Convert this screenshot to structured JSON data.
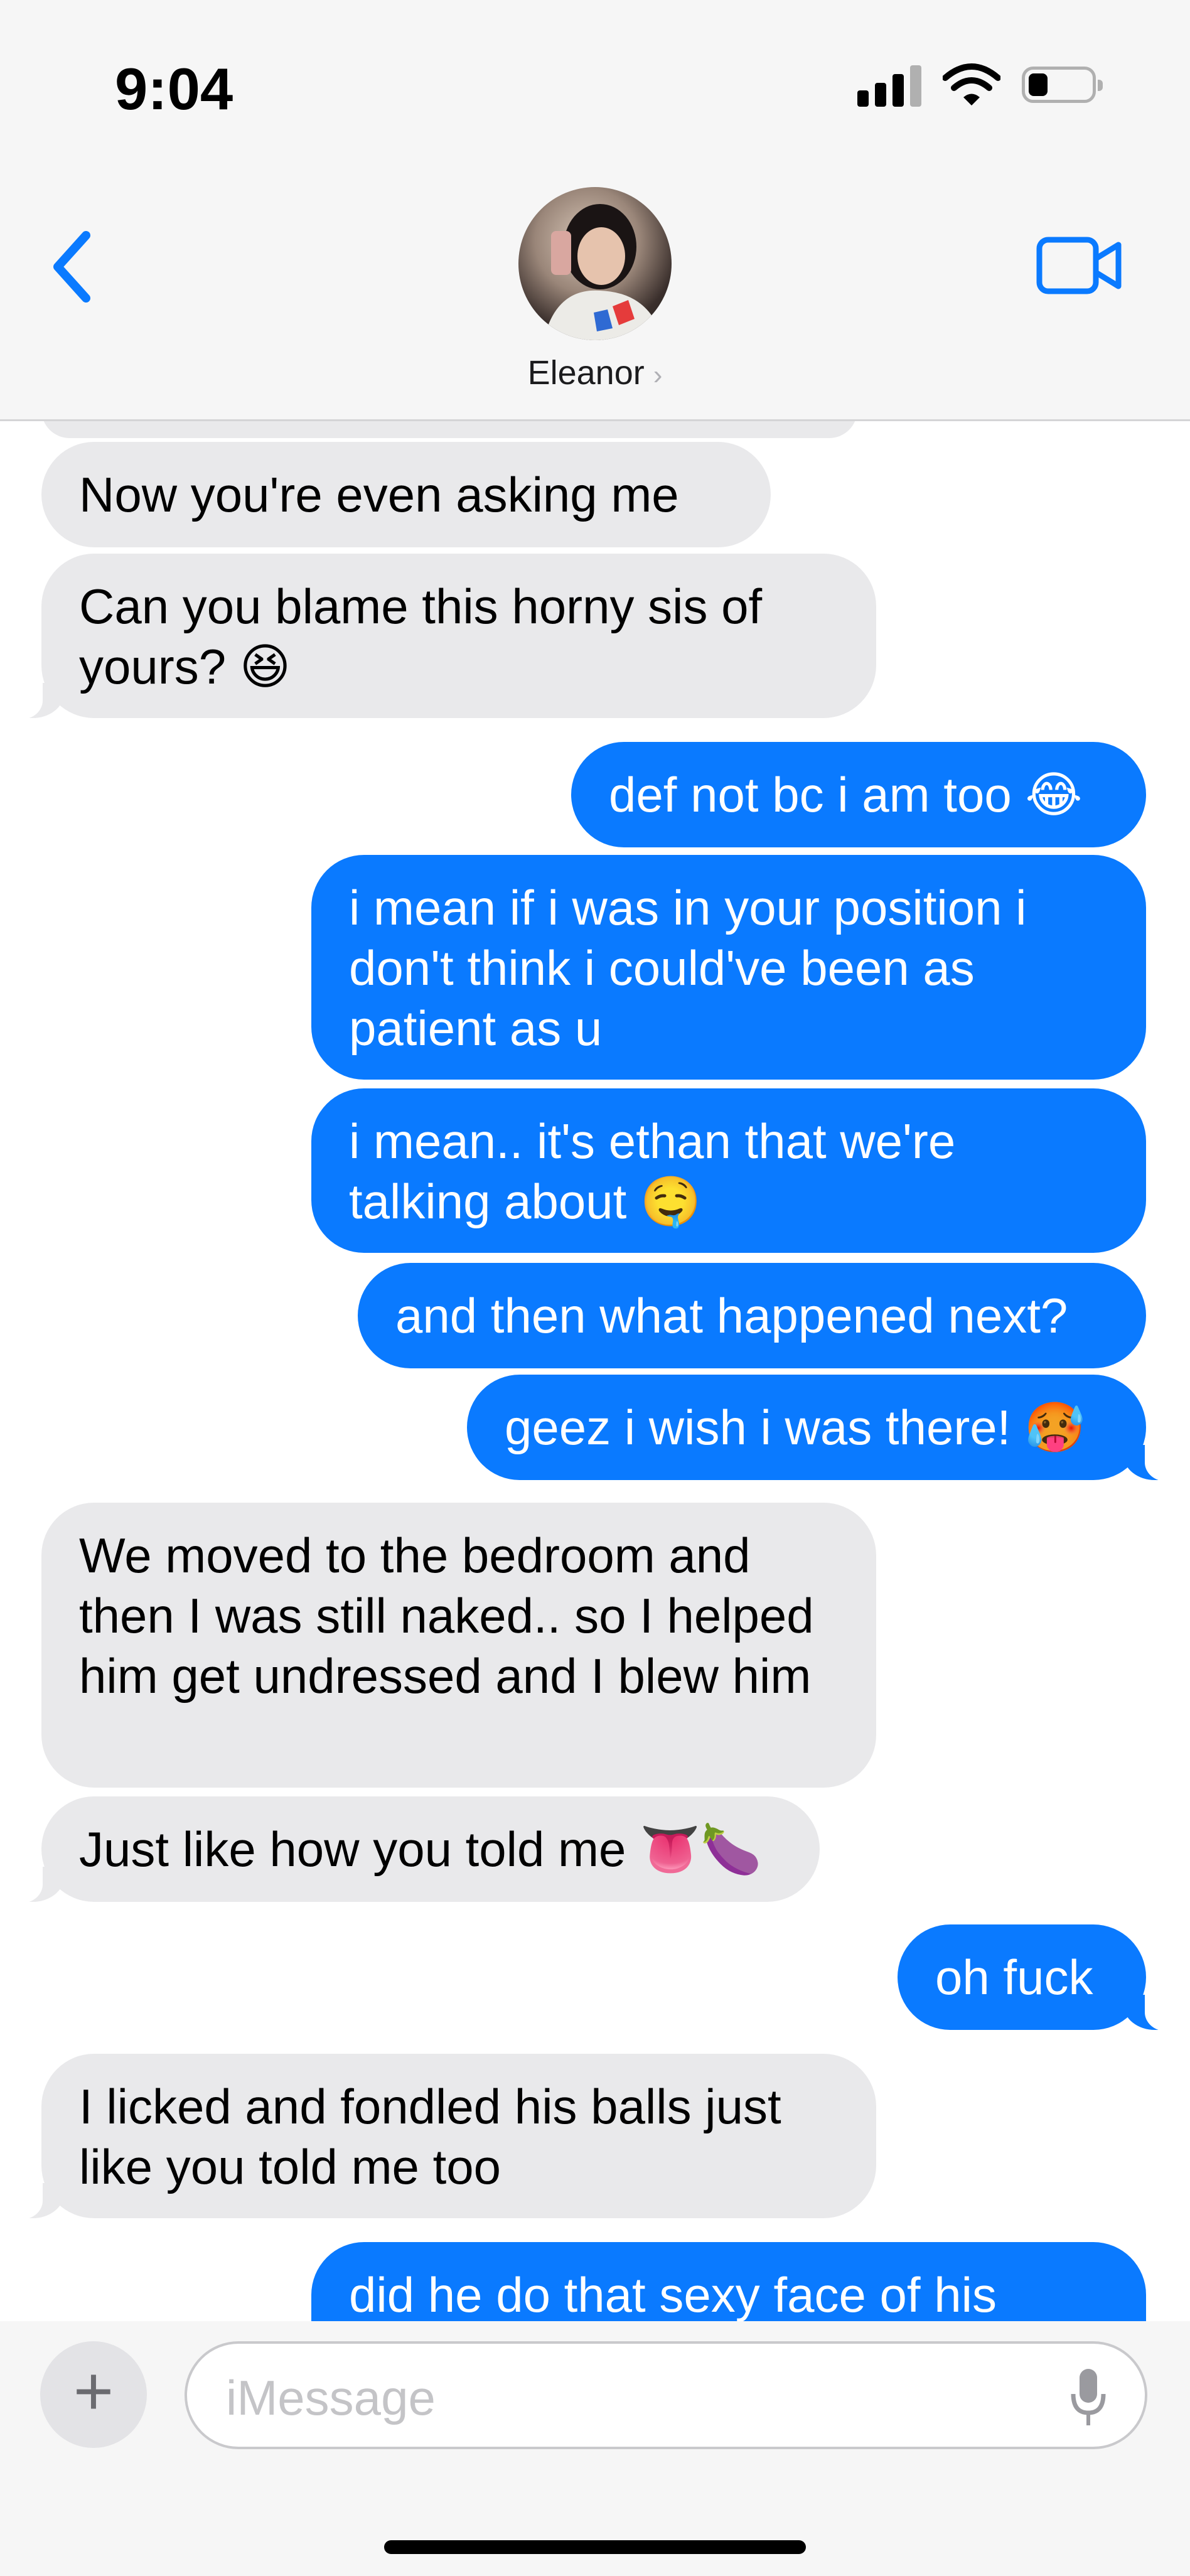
{
  "status_bar": {
    "time": "9:04"
  },
  "header": {
    "contact_name": "Eleanor",
    "chevron": "›",
    "avatar_icon": "person-photo-icon"
  },
  "messages": [
    {
      "from": "in",
      "text": "Now you're even asking me"
    },
    {
      "from": "in",
      "text": "Can you blame this horny sis of yours? 😆"
    },
    {
      "from": "out",
      "text": "def not bc i am too 😂"
    },
    {
      "from": "out",
      "text": "i mean if i was in your position i don't think i could've been as patient as u"
    },
    {
      "from": "out",
      "text": "i mean.. it's ethan that we're talking about 🤤"
    },
    {
      "from": "out",
      "text": "and then what happened next?"
    },
    {
      "from": "out",
      "text": "geez i wish i was there! 🥵"
    },
    {
      "from": "in",
      "text": "We moved to the bedroom and then I was still naked.. so I helped him get undressed and I blew him"
    },
    {
      "from": "in",
      "text": "Just like how you told me 👅🍆"
    },
    {
      "from": "out",
      "text": "oh fuck"
    },
    {
      "from": "in",
      "text": "I licked and fondled his balls just like you told me too"
    },
    {
      "from": "out",
      "text": "did he do that sexy face of his"
    }
  ],
  "composer": {
    "plus": "+",
    "placeholder": "iMessage"
  },
  "colors": {
    "outgoing": "#0a7aff",
    "incoming": "#e9e9eb",
    "accent": "#0a7aff"
  }
}
